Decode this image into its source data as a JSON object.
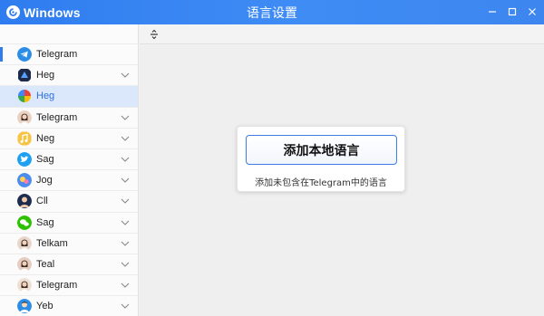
{
  "titlebar": {
    "app_name": "Windows",
    "title": "语言设置",
    "controls": [
      "minimize-icon",
      "maximize-icon",
      "close-icon"
    ]
  },
  "toolbar": {
    "icon": "sort-icon"
  },
  "accounts": [
    {
      "label": "Telegram",
      "avatar": "telegram-icon",
      "color": "#2b8de6",
      "active": true,
      "chevron": false
    },
    {
      "label": "Heg",
      "avatar": "app-icon",
      "color": "#1e2a4a",
      "chevron": true
    },
    {
      "label": "Heg",
      "avatar": "pinwheel-icon",
      "color": "#ea4335",
      "selected": true,
      "chevron": false
    },
    {
      "label": "Telegram",
      "avatar": "person-avatar",
      "color": "#e9d2c2",
      "chevron": true
    },
    {
      "label": "Neg",
      "avatar": "music-icon",
      "color": "#f6c343",
      "chevron": true
    },
    {
      "label": "Sag",
      "avatar": "bird-icon",
      "color": "#1da1f2",
      "chevron": true
    },
    {
      "label": "Jog",
      "avatar": "jog-icon",
      "color": "#4a8cf0",
      "chevron": true
    },
    {
      "label": "Cll",
      "avatar": "person-dark-avatar",
      "color": "#1d2b4f",
      "chevron": true
    },
    {
      "label": "Sag",
      "avatar": "wechat-icon",
      "color": "#2dc100",
      "chevron": true
    },
    {
      "label": "Telkam",
      "avatar": "person-avatar",
      "color": "#e8d6ca",
      "chevron": true
    },
    {
      "label": "Teal",
      "avatar": "person-avatar",
      "color": "#e6cdbf",
      "chevron": true
    },
    {
      "label": "Telegram",
      "avatar": "person-avatar",
      "color": "#efe0d4",
      "chevron": true
    },
    {
      "label": "Yeb",
      "avatar": "person-blue-avatar",
      "color": "#2b8de6",
      "chevron": true
    }
  ],
  "card": {
    "button_label": "添加本地语言",
    "description": "添加未包含在Telegram中的语言"
  },
  "colors": {
    "accent": "#2f7cf0",
    "selected_bg": "#dbe8fb"
  }
}
